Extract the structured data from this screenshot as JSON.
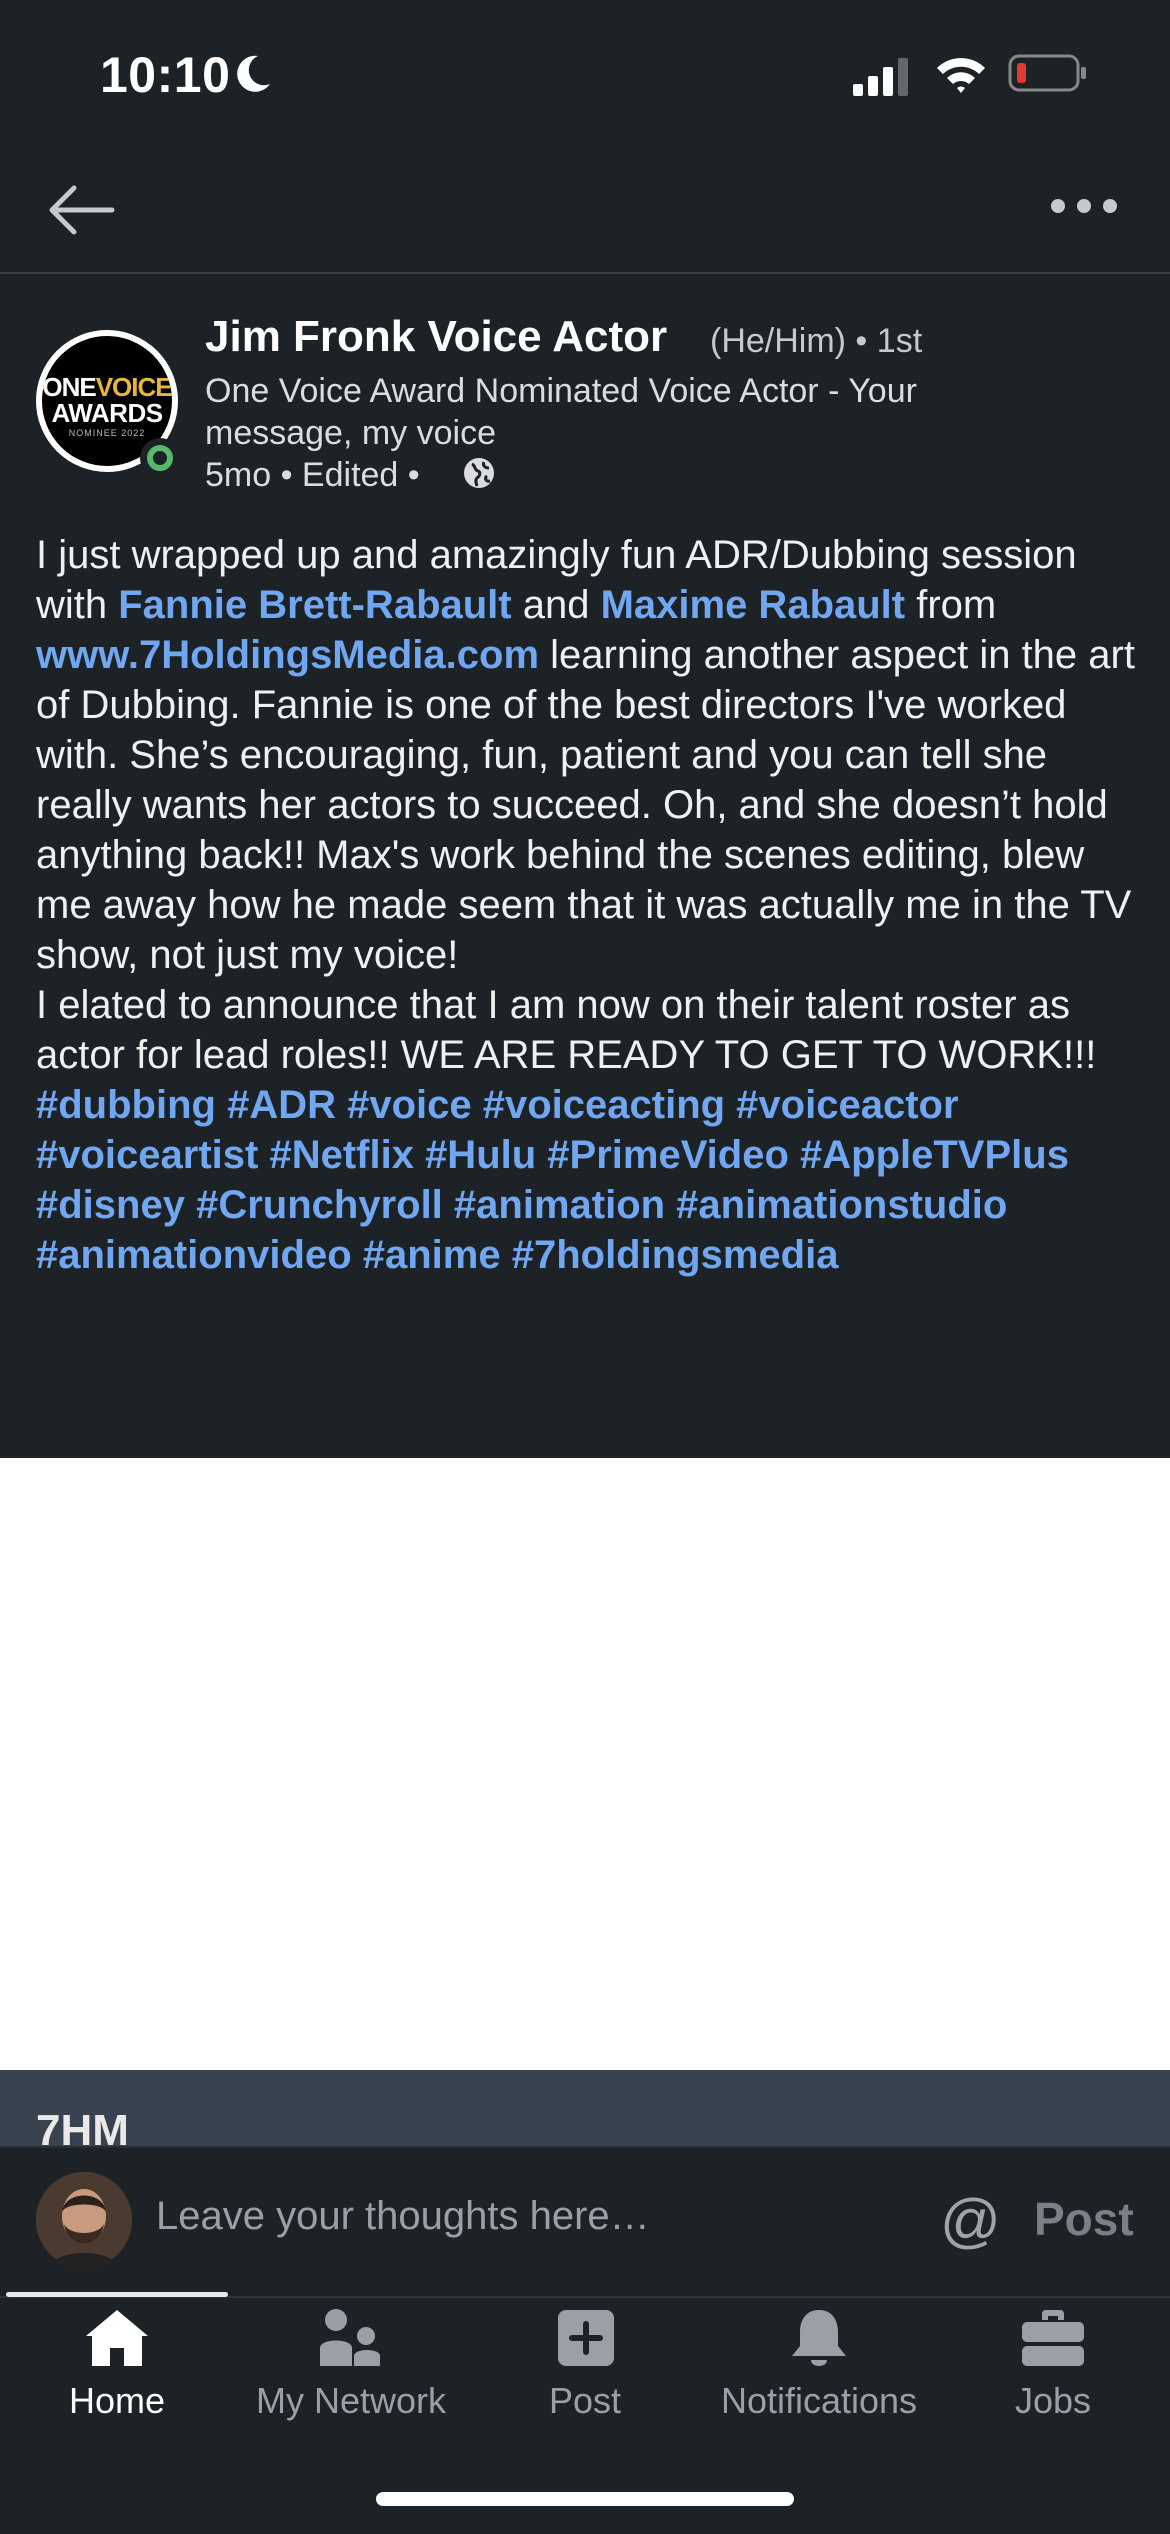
{
  "status_bar": {
    "time": "10:10"
  },
  "post": {
    "author": "Jim Fronk Voice Actor",
    "pronouns_degree": "(He/Him) • 1st",
    "headline": "One Voice Award Nominated Voice Actor - Your message, my voice",
    "meta": "5mo • Edited •",
    "avatar_logo": {
      "line1a": "ONE",
      "line1b": "VOICE",
      "line2": "AWARDS",
      "line3": "NOMINEE 2022"
    },
    "body": {
      "p1_a": "I just wrapped up and amazingly fun ADR/Dubbing session with ",
      "mention1": "Fannie Brett-Rabault",
      "p1_b": " and ",
      "mention2": "Maxime Rabault",
      "p1_c": " from ",
      "link": "www.7HoldingsMedia.com",
      "p1_d": " learning another aspect in the art of Dubbing. Fannie is one of the best directors I've worked with. She’s encouraging, fun, patient and you can tell she really wants her actors to succeed. Oh, and she  doesn’t hold anything back!! Max's work behind the scenes editing, blew me away how he made seem that it was actually me in the TV show, not just my voice!",
      "p2": "I elated to announce that I am now on their talent roster as actor for lead roles!! WE ARE READY TO GET TO WORK!!!",
      "hashtags": "#dubbing #ADR #voice #voiceacting #voiceactor #voiceartist #Netflix #Hulu #PrimeVideo #AppleTVPlus #disney #Crunchyroll #animation #animationstudio #animationvideo #anime #7holdingsmedia"
    },
    "preview_title": "7HM"
  },
  "comment": {
    "placeholder": "Leave your thoughts here…",
    "post_label": "Post"
  },
  "tabs": [
    {
      "label": "Home",
      "icon": "home-icon",
      "active": true
    },
    {
      "label": "My Network",
      "icon": "network-icon"
    },
    {
      "label": "Post",
      "icon": "plus-square-icon"
    },
    {
      "label": "Notifications",
      "icon": "bell-icon"
    },
    {
      "label": "Jobs",
      "icon": "briefcase-icon"
    }
  ],
  "colors": {
    "background": "#1d2226",
    "link": "#71a6f0",
    "online": "#58b96e"
  }
}
